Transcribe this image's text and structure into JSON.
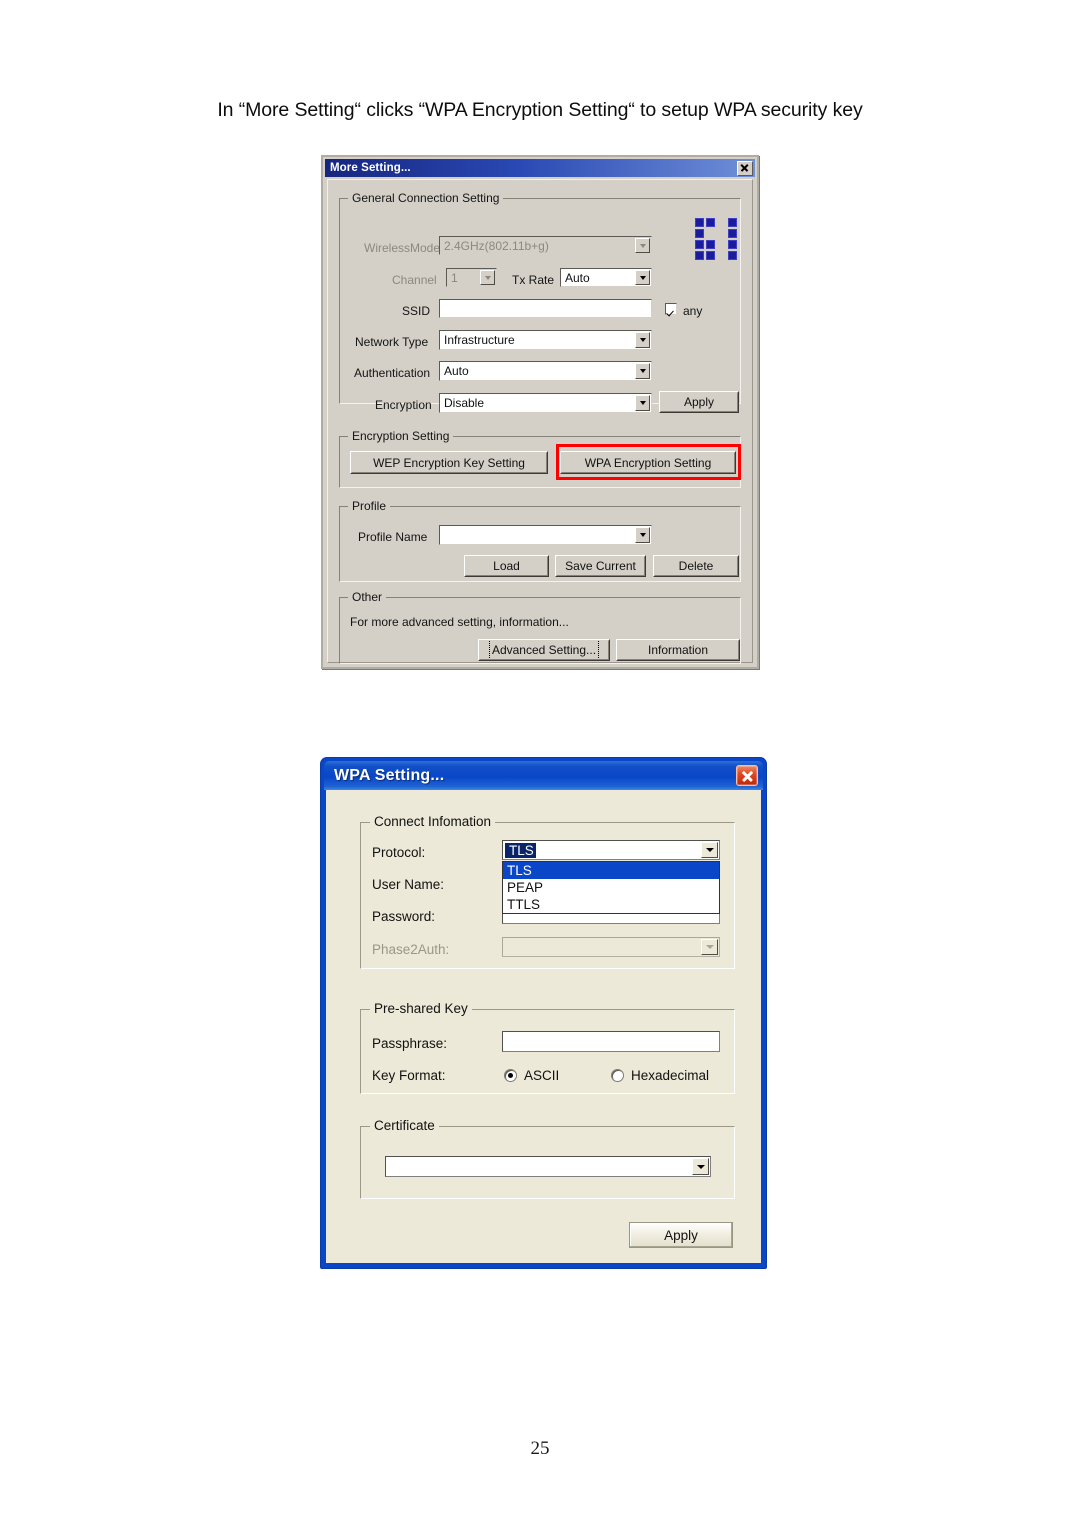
{
  "caption": "In “More Setting“ clicks “WPA Encryption Setting“ to setup WPA security key",
  "page_number": "25",
  "colors": {
    "highlight_box": "#ff0000",
    "classic_face": "#d4d0c8",
    "xp_face": "#ece9d8",
    "xp_title_blue": "#0a46c8",
    "selection_blue": "#0a246a"
  },
  "more_setting_dialog": {
    "title": "More Setting...",
    "close_label": "Close",
    "general_group": {
      "legend": "General Connection Setting",
      "wireless_mode_label": "WirelessMode",
      "wireless_mode_value": "2.4GHz(802.11b+g)",
      "wireless_mode_disabled": true,
      "channel_label": "Channel",
      "channel_value": "1",
      "channel_disabled": true,
      "tx_rate_label": "Tx Rate",
      "tx_rate_value": "Auto",
      "ssid_label": "SSID",
      "ssid_value": "",
      "any_label": "any",
      "any_checked": true,
      "network_type_label": "Network Type",
      "network_type_value": "Infrastructure",
      "authentication_label": "Authentication",
      "authentication_value": "Auto",
      "encryption_label": "Encryption",
      "encryption_value": "Disable",
      "apply_label": "Apply"
    },
    "encryption_group": {
      "legend": "Encryption Setting",
      "wep_button": "WEP Encryption Key Setting",
      "wpa_button": "WPA Encryption Setting",
      "wpa_button_highlighted": true
    },
    "profile_group": {
      "legend": "Profile",
      "profile_name_label": "Profile Name",
      "profile_name_value": "",
      "load_label": "Load",
      "save_current_label": "Save Current",
      "delete_label": "Delete"
    },
    "other_group": {
      "legend": "Other",
      "description": "For more advanced setting, information...",
      "advanced_setting_label": "Advanced Setting...",
      "information_label": "Information"
    }
  },
  "wpa_setting_dialog": {
    "title": "WPA Setting...",
    "close_label": "Close",
    "connect_group": {
      "legend": "Connect Infomation",
      "protocol_label": "Protocol:",
      "protocol_value": "TLS",
      "protocol_options": [
        "TLS",
        "PEAP",
        "TTLS"
      ],
      "protocol_selected_index": 0,
      "protocol_dropdown_open": true,
      "user_name_label": "User Name:",
      "user_name_value": "",
      "password_label": "Password:",
      "password_value": "",
      "phase2auth_label": "Phase2Auth:",
      "phase2auth_value": "",
      "phase2auth_disabled": true
    },
    "preshared_group": {
      "legend": "Pre-shared Key",
      "passphrase_label": "Passphrase:",
      "passphrase_value": "",
      "key_format_label": "Key Format:",
      "ascii_label": "ASCII",
      "hexadecimal_label": "Hexadecimal",
      "key_format_selected": "ASCII"
    },
    "certificate_group": {
      "legend": "Certificate",
      "certificate_value": ""
    },
    "apply_label": "Apply"
  }
}
